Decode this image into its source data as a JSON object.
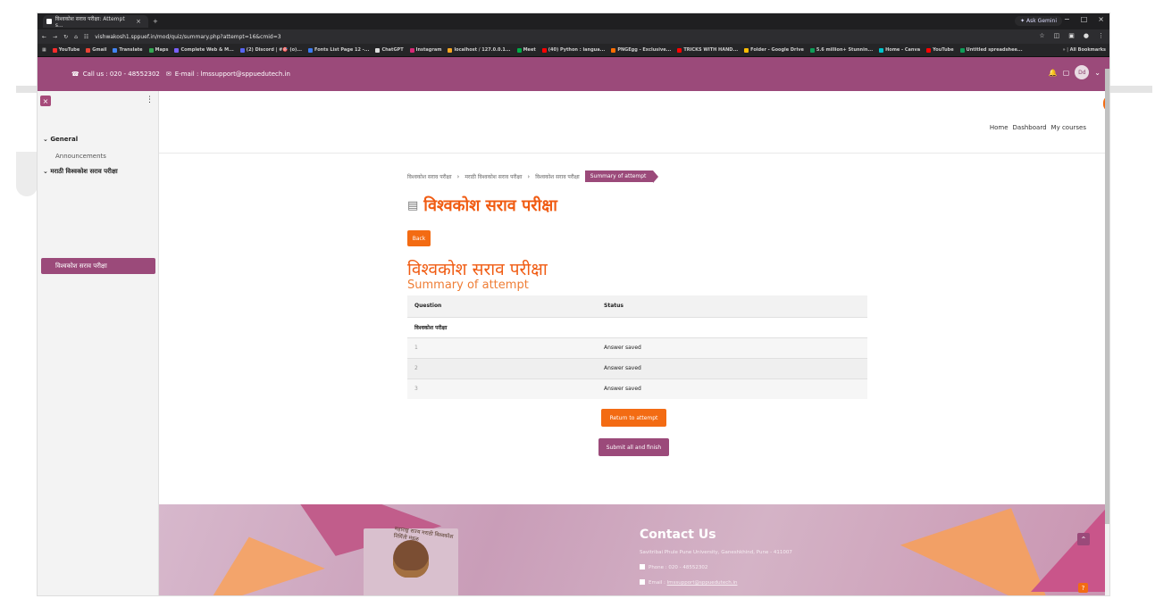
{
  "browser": {
    "tab_title": "विश्वकोश सराव परीक्षा: Attempt s...",
    "url": "vishwakosh1.sppuef.in/mod/quiz/summary.php?attempt=16&cmid=3",
    "gemini": "✦ Ask Gemini",
    "all_bookmarks": "All Bookmarks",
    "bookmarks": [
      "YouTube",
      "Gmail",
      "Translate",
      "Maps",
      "Complete Web & M...",
      "(2) Discord | #🎯 (o)...",
      "Fonts List Page 12 -...",
      "ChatGPT",
      "Instagram",
      "localhost / 127.0.0.1...",
      "Meet",
      "(40) Python : langua...",
      "PNGEgg - Exclusive...",
      "TRICKS WITH HAND...",
      "Folder - Google Drive",
      "5.6 million+ Stunnin...",
      "Home - Canva",
      "YouTube",
      "Untitled spreadshee..."
    ]
  },
  "topbar": {
    "call": "Call us : 020 - 48552302",
    "email": "E-mail : lmssupport@sppuedutech.in",
    "avatar": "Dd"
  },
  "drawer": {
    "general": "General",
    "announcements": "Announcements",
    "section": "मराठी विश्वकोश सराव परीक्षा",
    "active": "विश्वकोश सराव परीक्षा"
  },
  "header": {
    "home": "Home",
    "dashboard": "Dashboard",
    "courses": "My courses"
  },
  "breadcrumb": {
    "item1": "विश्वकोश सराव परीक्षा",
    "item2": "मराठी विश्वकोश सराव परीक्षा",
    "item3": "विश्वकोश सराव परीक्षा",
    "active": "Summary of attempt"
  },
  "content": {
    "page_title": "विश्वकोश सराव परीक्षा",
    "back": "Back",
    "main_heading": "विश्वकोश सराव परीक्षा",
    "sub_heading": "Summary of attempt",
    "return_button": "Return to attempt",
    "submit_button": "Submit all and finish"
  },
  "table": {
    "headers": [
      "Question",
      "Status"
    ],
    "section": "विश्वकोश परीक्षा",
    "rows": [
      {
        "question": "1",
        "status": "Answer saved"
      },
      {
        "question": "2",
        "status": "Answer saved"
      },
      {
        "question": "3",
        "status": "Answer saved"
      }
    ]
  },
  "footer": {
    "contact_title": "Contact Us",
    "address": "Savitribai Phule Pune University, Ganeshkhind, Pune - 411007",
    "phone": "Phone : 020 - 48552302",
    "email_label": "Email : ",
    "email": "lmssupport@sppuedutech.in",
    "logo_text": "महाराष्ट्र राज्य मराठी विश्वकोश निर्मिती मंडळ"
  },
  "colors": {
    "brand": "#9b4a7a",
    "accent": "#f36b13"
  }
}
